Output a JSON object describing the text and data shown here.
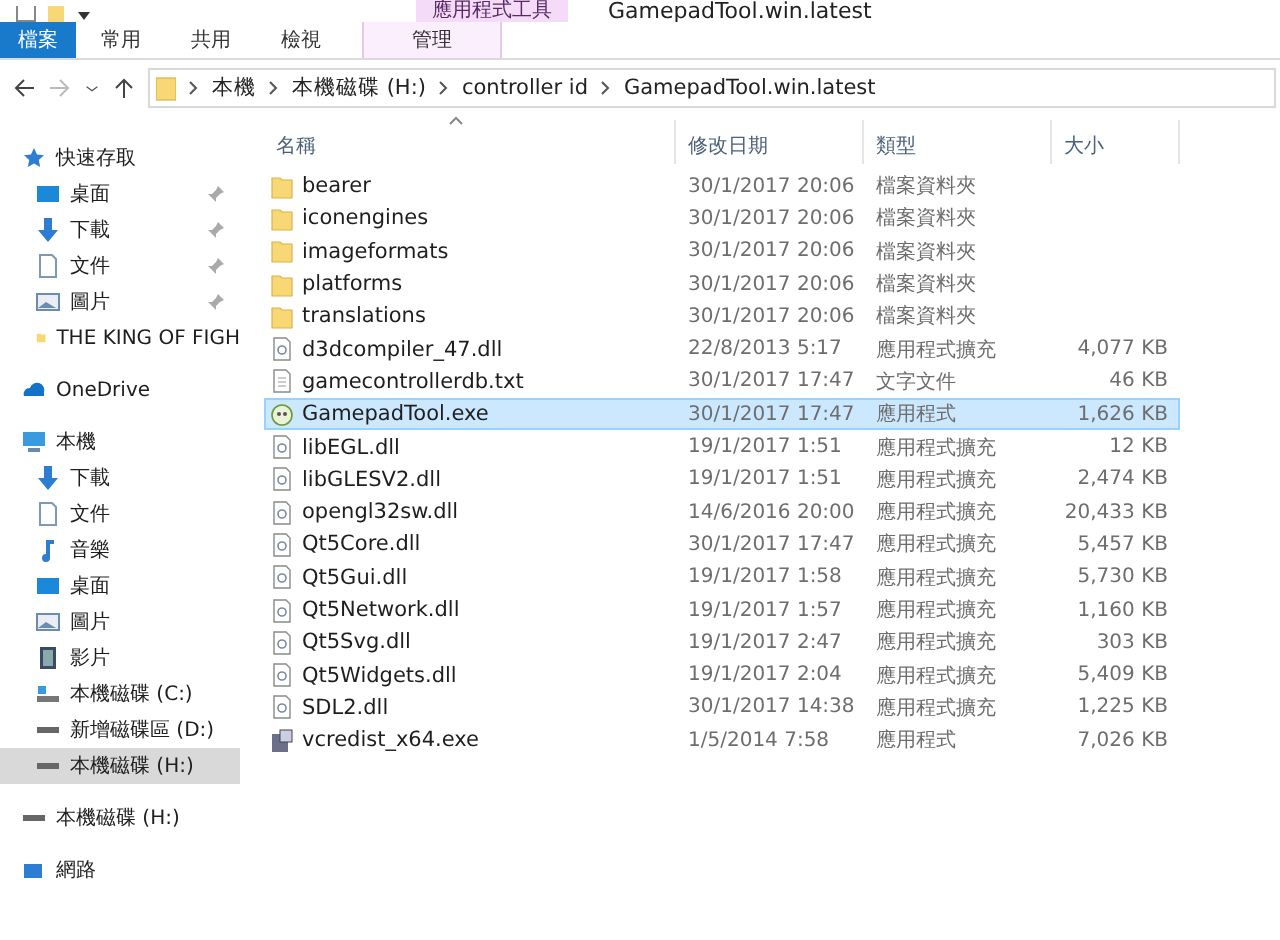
{
  "window": {
    "title": "GamepadTool.win.latest",
    "context_tab": "應用程式工具"
  },
  "ribbon_tabs": [
    {
      "label": "檔案",
      "kind": "file",
      "selected": false
    },
    {
      "label": "常用",
      "kind": "tab",
      "selected": false
    },
    {
      "label": "共用",
      "kind": "tab",
      "selected": false
    },
    {
      "label": "檢視",
      "kind": "tab",
      "selected": false
    },
    {
      "label": "管理",
      "kind": "context",
      "selected": false
    }
  ],
  "address": {
    "path": [
      "本機",
      "本機磁碟 (H:)",
      "controller id",
      "GamepadTool.win.latest"
    ]
  },
  "sidebar": [
    {
      "label": "快速存取",
      "kind": "star",
      "selected": false,
      "children": [
        {
          "label": "桌面",
          "kind": "desktop",
          "pinned": true,
          "selected": false
        },
        {
          "label": "下載",
          "kind": "download",
          "pinned": true,
          "selected": false
        },
        {
          "label": "文件",
          "kind": "document",
          "pinned": true,
          "selected": false
        },
        {
          "label": "圖片",
          "kind": "picture",
          "pinned": true,
          "selected": false
        },
        {
          "label": "THE KING OF FIGH",
          "kind": "folder",
          "pinned": false,
          "selected": false
        }
      ]
    },
    {
      "label": "OneDrive",
      "kind": "cloud",
      "selected": false
    },
    {
      "label": "本機",
      "kind": "pc",
      "selected": false,
      "children": [
        {
          "label": "下載",
          "kind": "download",
          "pinned": false,
          "selected": false
        },
        {
          "label": "文件",
          "kind": "document",
          "pinned": false,
          "selected": false
        },
        {
          "label": "音樂",
          "kind": "music",
          "pinned": false,
          "selected": false
        },
        {
          "label": "桌面",
          "kind": "desktop",
          "pinned": false,
          "selected": false
        },
        {
          "label": "圖片",
          "kind": "picture",
          "pinned": false,
          "selected": false
        },
        {
          "label": "影片",
          "kind": "video",
          "pinned": false,
          "selected": false
        },
        {
          "label": "本機磁碟 (C:)",
          "kind": "sysdrive",
          "pinned": false,
          "selected": false
        },
        {
          "label": "新增磁碟區 (D:)",
          "kind": "drive",
          "pinned": false,
          "selected": false
        },
        {
          "label": "本機磁碟 (H:)",
          "kind": "drive",
          "pinned": false,
          "selected": true
        }
      ]
    },
    {
      "label": "本機磁碟 (H:)",
      "kind": "drive",
      "selected": false
    },
    {
      "label": "網路",
      "kind": "network",
      "selected": false
    }
  ],
  "table": {
    "columns": [
      "名稱",
      "修改日期",
      "類型",
      "大小"
    ],
    "rows": [
      {
        "name": "bearer",
        "date": "30/1/2017 20:06",
        "type": "檔案資料夾",
        "kind": "folder",
        "selected": false
      },
      {
        "name": "iconengines",
        "date": "30/1/2017 20:06",
        "type": "檔案資料夾",
        "kind": "folder",
        "selected": false
      },
      {
        "name": "imageformats",
        "date": "30/1/2017 20:06",
        "type": "檔案資料夾",
        "kind": "folder",
        "selected": false
      },
      {
        "name": "platforms",
        "date": "30/1/2017 20:06",
        "type": "檔案資料夾",
        "kind": "folder",
        "selected": false
      },
      {
        "name": "translations",
        "date": "30/1/2017 20:06",
        "type": "檔案資料夾",
        "kind": "folder",
        "selected": false
      },
      {
        "name": "d3dcompiler_47.dll",
        "date": "22/8/2013 5:17",
        "type": "應用程式擴充",
        "size": "4,077 KB",
        "kind": "dll",
        "selected": false
      },
      {
        "name": "gamecontrollerdb.txt",
        "date": "30/1/2017 17:47",
        "type": "文字文件",
        "size": "46 KB",
        "kind": "text",
        "selected": false
      },
      {
        "name": "GamepadTool.exe",
        "date": "30/1/2017 17:47",
        "type": "應用程式",
        "size": "1,626 KB",
        "kind": "app",
        "selected": true
      },
      {
        "name": "libEGL.dll",
        "date": "19/1/2017 1:51",
        "type": "應用程式擴充",
        "size": "12 KB",
        "kind": "dll",
        "selected": false
      },
      {
        "name": "libGLESV2.dll",
        "date": "19/1/2017 1:51",
        "type": "應用程式擴充",
        "size": "2,474 KB",
        "kind": "dll",
        "selected": false
      },
      {
        "name": "opengl32sw.dll",
        "date": "14/6/2016 20:00",
        "type": "應用程式擴充",
        "size": "20,433 KB",
        "kind": "dll",
        "selected": false
      },
      {
        "name": "Qt5Core.dll",
        "date": "30/1/2017 17:47",
        "type": "應用程式擴充",
        "size": "5,457 KB",
        "kind": "dll",
        "selected": false
      },
      {
        "name": "Qt5Gui.dll",
        "date": "19/1/2017 1:58",
        "type": "應用程式擴充",
        "size": "5,730 KB",
        "kind": "dll",
        "selected": false
      },
      {
        "name": "Qt5Network.dll",
        "date": "19/1/2017 1:57",
        "type": "應用程式擴充",
        "size": "1,160 KB",
        "kind": "dll",
        "selected": false
      },
      {
        "name": "Qt5Svg.dll",
        "date": "19/1/2017 2:47",
        "type": "應用程式擴充",
        "size": "303 KB",
        "kind": "dll",
        "selected": false
      },
      {
        "name": "Qt5Widgets.dll",
        "date": "19/1/2017 2:04",
        "type": "應用程式擴充",
        "size": "5,409 KB",
        "kind": "dll",
        "selected": false
      },
      {
        "name": "SDL2.dll",
        "date": "30/1/2017 14:38",
        "type": "應用程式擴充",
        "size": "1,225 KB",
        "kind": "dll",
        "selected": false
      },
      {
        "name": "vcredist_x64.exe",
        "date": "1/5/2014 7:58",
        "type": "應用程式",
        "size": "7,026 KB",
        "kind": "installer",
        "selected": false
      }
    ]
  }
}
